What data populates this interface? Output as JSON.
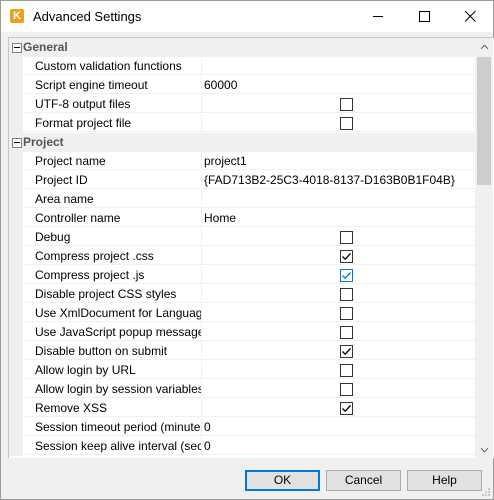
{
  "window": {
    "title": "Advanced Settings",
    "app_icon_letter": "K"
  },
  "categories": [
    {
      "label": "General",
      "items": [
        {
          "name": "Custom validation functions",
          "value": "",
          "type": "text"
        },
        {
          "name": "Script engine timeout",
          "value": "60000",
          "type": "text"
        },
        {
          "name": "UTF-8 output files",
          "checked": false,
          "type": "checkbox"
        },
        {
          "name": "Format project file",
          "checked": false,
          "type": "checkbox"
        }
      ]
    },
    {
      "label": "Project",
      "items": [
        {
          "name": "Project name",
          "value": "project1",
          "type": "text"
        },
        {
          "name": "Project ID",
          "value": "{FAD713B2-25C3-4018-8137-D163B0B1F04B}",
          "type": "text"
        },
        {
          "name": "Area name",
          "value": "",
          "type": "text"
        },
        {
          "name": "Controller name",
          "value": "Home",
          "type": "text"
        },
        {
          "name": "Debug",
          "checked": false,
          "type": "checkbox"
        },
        {
          "name": "Compress project .css",
          "checked": true,
          "type": "checkbox"
        },
        {
          "name": "Compress project .js",
          "checked": true,
          "type": "checkbox",
          "hover": true
        },
        {
          "name": "Disable project CSS styles",
          "checked": false,
          "type": "checkbox"
        },
        {
          "name": "Use XmlDocument for Language ol",
          "checked": false,
          "type": "checkbox"
        },
        {
          "name": "Use JavaScript popup message",
          "checked": false,
          "type": "checkbox"
        },
        {
          "name": "Disable button on submit",
          "checked": true,
          "type": "checkbox"
        },
        {
          "name": "Allow login by URL",
          "checked": false,
          "type": "checkbox"
        },
        {
          "name": "Allow login by session variables",
          "checked": false,
          "type": "checkbox"
        },
        {
          "name": "Remove XSS",
          "checked": true,
          "type": "checkbox"
        },
        {
          "name": "Session timeout period (minutes)",
          "value": "0",
          "type": "text"
        },
        {
          "name": "Session keep alive interval (secon",
          "value": "0",
          "type": "text"
        }
      ]
    }
  ],
  "buttons": {
    "ok": "OK",
    "cancel": "Cancel",
    "help": "Help"
  },
  "colors": {
    "checkbox_hover": "#0078d7",
    "default_button_border": "#0078d7"
  },
  "icons": {
    "minimize": "minimize-icon",
    "maximize": "maximize-icon",
    "close": "close-icon",
    "collapse": "minus-box-icon",
    "checkmark": "checkmark-icon"
  }
}
